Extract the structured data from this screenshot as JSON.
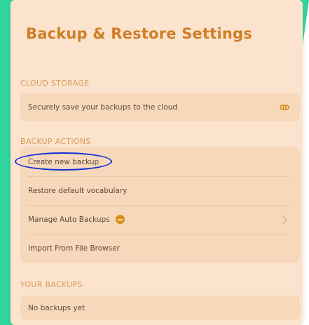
{
  "page": {
    "title": "Backup & Restore Settings"
  },
  "cloud": {
    "header": "CLOUD STORAGE",
    "item_label": "Securely save your backups to the cloud",
    "item_icon": "link-icon"
  },
  "actions": {
    "header": "BACKUP ACTIONS",
    "items": [
      {
        "label": "Create new backup"
      },
      {
        "label": "Restore default vocabulary"
      },
      {
        "label": "Manage Auto Backups",
        "badge_icon": "minus-badge-icon",
        "trailing_icon": "chevron-right-icon"
      },
      {
        "label": "Import From File Browser"
      }
    ]
  },
  "backups": {
    "header": "YOUR BACKUPS",
    "empty_label": "No backups yet"
  },
  "colors": {
    "accent": "#d07e26",
    "panel": "#fbe3cd",
    "card": "#f7d8bb",
    "annotation": "#1030d8",
    "background_green": "#2fd59a"
  }
}
